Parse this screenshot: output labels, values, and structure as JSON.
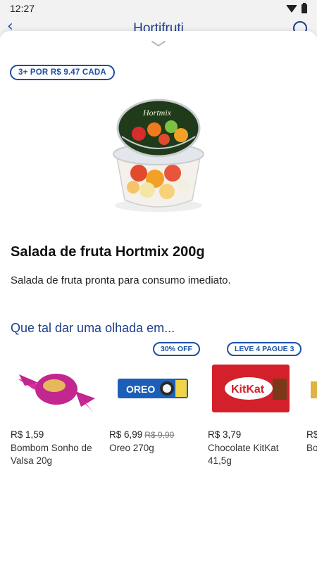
{
  "status_bar": {
    "time": "12:27"
  },
  "header": {
    "title": "Hortifruti"
  },
  "product": {
    "promo_badge": "3+ POR R$ 9.47 CADA",
    "title": "Salada de fruta Hortmix 200g",
    "description": "Salada de fruta pronta para consumo imediato."
  },
  "recommendations": {
    "title": "Que tal dar uma olhada em...",
    "items": [
      {
        "badge": "",
        "price": "R$ 1,59",
        "old_price": "",
        "name": "Bombom Sonho de Valsa 20g"
      },
      {
        "badge": "30% OFF",
        "price": "R$ 6,99",
        "old_price": "R$ 9,99",
        "name": "Oreo 270g"
      },
      {
        "badge": "LEVE 4 PAGUE 3",
        "price": "R$ 3,79",
        "old_price": "",
        "name": "Chocolate KitKat 41,5g"
      },
      {
        "badge": "",
        "price": "R$",
        "old_price": "",
        "name": "Bo Bra"
      }
    ]
  },
  "colors": {
    "accent": "#1b4fa6",
    "kitkat_red": "#d3202a",
    "oreo_blue": "#1c5fb8",
    "bonbon_pink": "#c2268f"
  }
}
